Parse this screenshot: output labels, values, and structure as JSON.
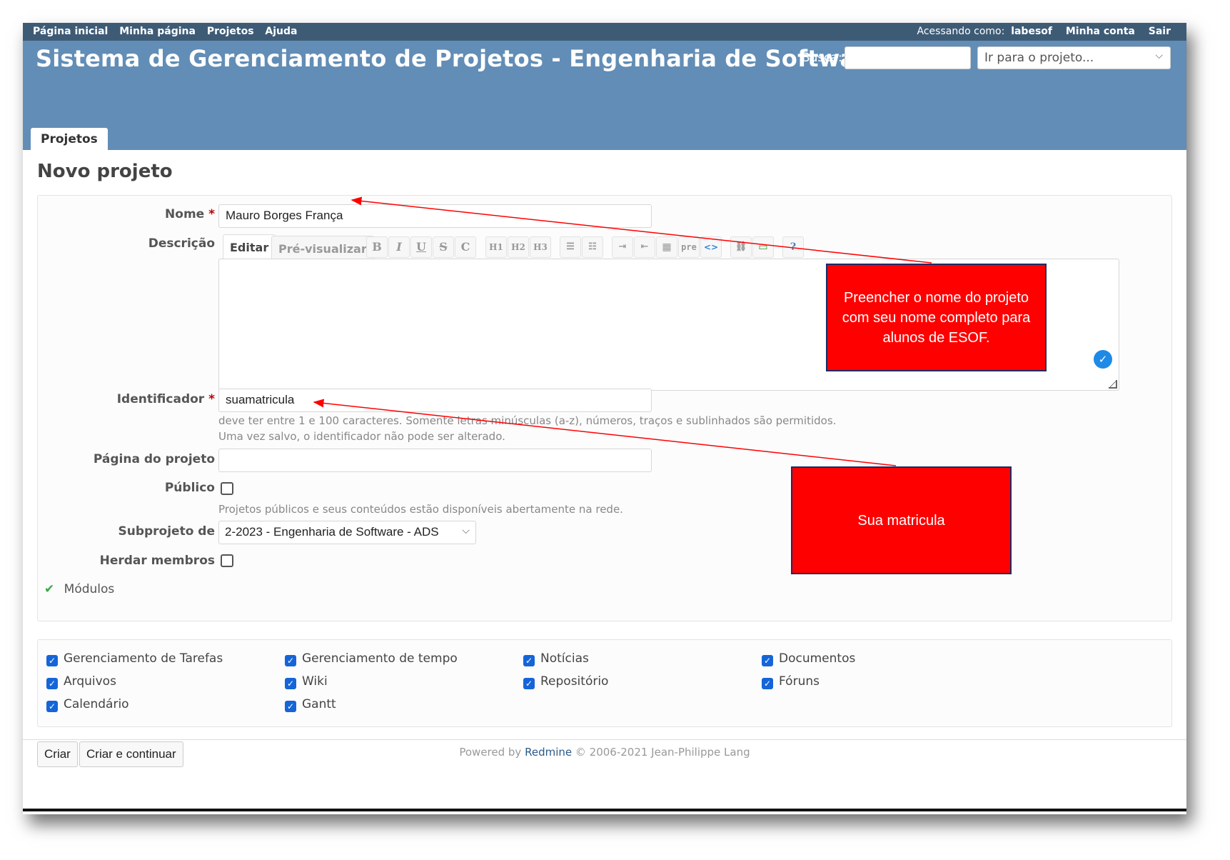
{
  "top_menu": {
    "home": "Página inicial",
    "my_page": "Minha página",
    "projects": "Projetos",
    "help": "Ajuda",
    "logged_as_label": "Acessando como:",
    "user": "labesof",
    "my_account": "Minha conta",
    "logout": "Sair"
  },
  "header": {
    "title": "Sistema de Gerenciamento de Projetos - Engenharia de Software",
    "search_label": "Busca:",
    "search_value": "",
    "jump_placeholder": "Ir para o projeto..."
  },
  "main_tab": "Projetos",
  "page_title": "Novo projeto",
  "form": {
    "name_label": "Nome",
    "name_value": "Mauro Borges França",
    "description_label": "Descrição",
    "desc_tabs": [
      "Editar",
      "Pré-visualizar"
    ],
    "toolbar": [
      "B",
      "I",
      "U",
      "S",
      "C",
      "H1",
      "H2",
      "H3",
      "ul",
      "ol",
      "indent-right",
      "indent-left",
      "table",
      "pre",
      "<>",
      "link",
      "image",
      "help"
    ],
    "identifier_label": "Identificador",
    "identifier_value": "suamatricula",
    "identifier_hint1": "deve ter entre 1 e 100 caracteres. Somente letras minúsculas (a-z), números, traços e sublinhados são permitidos.",
    "identifier_hint2": "Uma vez salvo, o identificador não pode ser alterado.",
    "homepage_label": "Página do projeto",
    "public_label": "Público",
    "public_hint": "Projetos públicos e seus conteúdos estão disponíveis abertamente na rede.",
    "parent_label": "Subprojeto de",
    "parent_value": "2-2023 - Engenharia de Software - ADS",
    "inherit_label": "Herdar membros"
  },
  "modules": {
    "legend": "Módulos",
    "items": [
      "Gerenciamento de Tarefas",
      "Gerenciamento de tempo",
      "Notícias",
      "Documentos",
      "Arquivos",
      "Wiki",
      "Repositório",
      "Fóruns",
      "Calendário",
      "Gantt"
    ]
  },
  "buttons": {
    "create": "Criar",
    "create_continue": "Criar e continuar"
  },
  "footer": {
    "powered": "Powered by",
    "link": "Redmine",
    "copyright": "© 2006-2021 Jean-Philippe Lang"
  },
  "annotations": {
    "callout_name": "Preencher o nome do projeto com seu nome completo para alunos de ESOF.",
    "callout_id": "Sua matricula"
  },
  "colors": {
    "header": "#628db6",
    "top_menu": "#3e5b76",
    "callout": "#ff0000",
    "arrow": "#ff0000",
    "checkbox": "#1565d8"
  }
}
